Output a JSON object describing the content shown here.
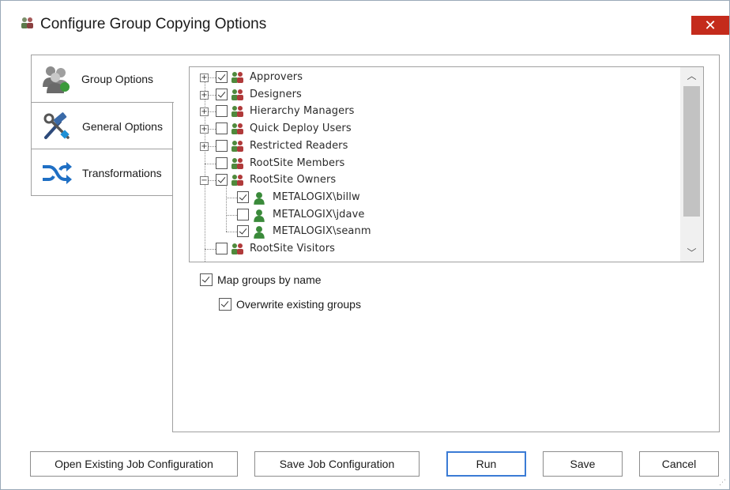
{
  "window": {
    "title": "Configure Group Copying Options",
    "close_label": "✕"
  },
  "tabs": [
    {
      "label": "Group Options",
      "icon": "users-group-icon",
      "active": true
    },
    {
      "label": "General Options",
      "icon": "hammer-wrench-icon",
      "active": false
    },
    {
      "label": "Transformations",
      "icon": "shuffle-arrows-icon",
      "active": false
    }
  ],
  "tree": {
    "items": [
      {
        "label": "Approvers",
        "expander": "+",
        "checked": true,
        "kind": "group"
      },
      {
        "label": "Designers",
        "expander": "+",
        "checked": true,
        "kind": "group"
      },
      {
        "label": "Hierarchy Managers",
        "expander": "+",
        "checked": false,
        "kind": "group"
      },
      {
        "label": "Quick Deploy Users",
        "expander": "+",
        "checked": false,
        "kind": "group"
      },
      {
        "label": "Restricted Readers",
        "expander": "+",
        "checked": false,
        "kind": "group"
      },
      {
        "label": "RootSite Members",
        "expander": "",
        "checked": false,
        "kind": "group"
      },
      {
        "label": "RootSite Owners",
        "expander": "−",
        "checked": true,
        "kind": "group"
      },
      {
        "label": "METALOGIX\\billw",
        "expander": "",
        "checked": true,
        "kind": "user"
      },
      {
        "label": "METALOGIX\\jdave",
        "expander": "",
        "checked": false,
        "kind": "user"
      },
      {
        "label": "METALOGIX\\seanm",
        "expander": "",
        "checked": true,
        "kind": "user"
      },
      {
        "label": "RootSite Visitors",
        "expander": "",
        "checked": false,
        "kind": "group"
      }
    ]
  },
  "options": {
    "map_groups": {
      "label": "Map groups by name",
      "checked": true
    },
    "overwrite_groups": {
      "label": "Overwrite existing groups",
      "checked": true
    }
  },
  "buttons": {
    "open_config": "Open Existing Job Configuration",
    "save_config": "Save Job Configuration",
    "run": "Run",
    "save": "Save",
    "cancel": "Cancel"
  },
  "colors": {
    "close_red": "#c42b1c",
    "default_button_border": "#3a7bd5",
    "group_icon_green": "#4f8a3c",
    "group_icon_red": "#b03a3a"
  }
}
